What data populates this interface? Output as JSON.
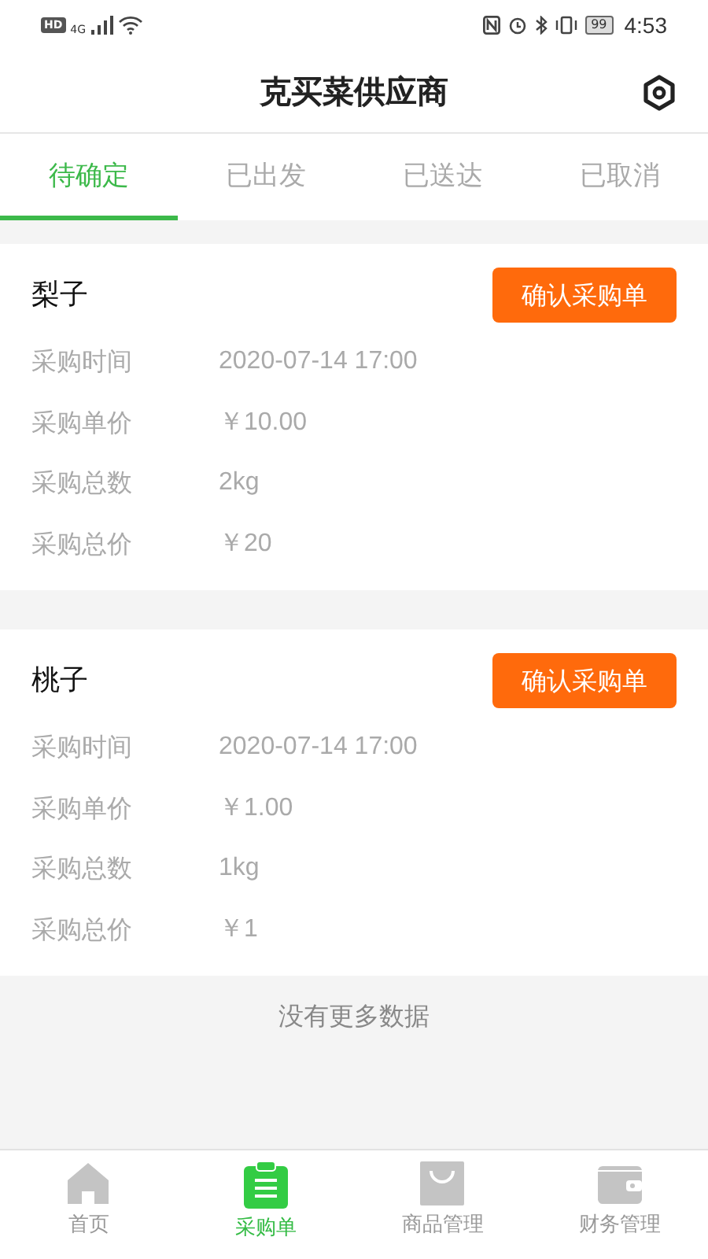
{
  "status_bar": {
    "hd": "HD",
    "network": "4G",
    "battery": "99",
    "time": "4:53"
  },
  "header": {
    "title": "克买菜供应商"
  },
  "tabs": [
    {
      "label": "待确定",
      "selected": true
    },
    {
      "label": "已出发",
      "selected": false
    },
    {
      "label": "已送达",
      "selected": false
    },
    {
      "label": "已取消",
      "selected": false
    }
  ],
  "orders": [
    {
      "name": "梨子",
      "button": "确认采购单",
      "fields": [
        {
          "label": "采购时间",
          "value": "2020-07-14 17:00"
        },
        {
          "label": "采购单价",
          "value": "￥10.00"
        },
        {
          "label": "采购总数",
          "value": "2kg"
        },
        {
          "label": "采购总价",
          "value": "￥20"
        }
      ]
    },
    {
      "name": "桃子",
      "button": "确认采购单",
      "fields": [
        {
          "label": "采购时间",
          "value": "2020-07-14 17:00"
        },
        {
          "label": "采购单价",
          "value": "￥1.00"
        },
        {
          "label": "采购总数",
          "value": "1kg"
        },
        {
          "label": "采购总价",
          "value": "￥1"
        }
      ]
    }
  ],
  "end_note": "没有更多数据",
  "bottom_nav": [
    {
      "label": "首页",
      "kind": "home",
      "selected": false
    },
    {
      "label": "采购单",
      "kind": "orders",
      "selected": true
    },
    {
      "label": "商品管理",
      "kind": "goods",
      "selected": false
    },
    {
      "label": "财务管理",
      "kind": "finance",
      "selected": false
    }
  ]
}
